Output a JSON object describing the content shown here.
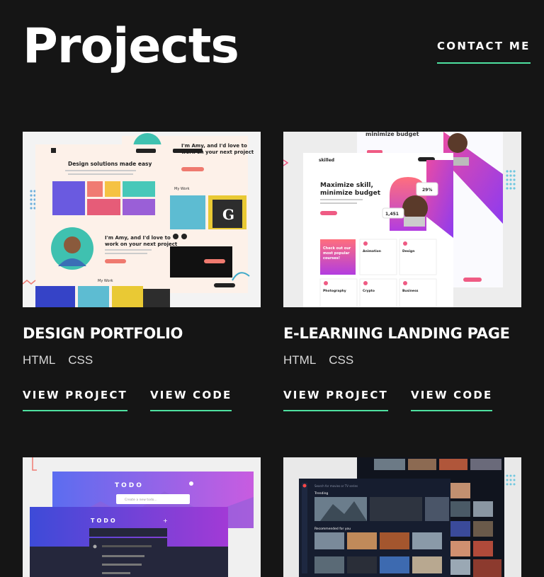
{
  "header": {
    "title": "Projects",
    "contact_label": "CONTACT ME"
  },
  "accent": "#4ee1a0",
  "projects": [
    {
      "title": "DESIGN PORTFOLIO",
      "tags": [
        "HTML",
        "CSS"
      ],
      "view_project": "VIEW PROJECT",
      "view_code": "VIEW CODE",
      "thumb_text": {
        "heading": "Design solutions made easy",
        "intro": "I'm Amy, and I'd love to work on your next project",
        "intro2": "I'm Amy, and I'd love to work on your next project",
        "section": "My Work",
        "section2": "My Work"
      }
    },
    {
      "title": "E-LEARNING LANDING PAGE",
      "tags": [
        "HTML",
        "CSS"
      ],
      "view_project": "VIEW PROJECT",
      "view_code": "VIEW CODE",
      "thumb_text": {
        "brand": "skilled",
        "heading": "Maximize skill, minimize budget",
        "top": "minimize budget",
        "stat1": "29%",
        "stat2": "1,451",
        "cta": "Check out our most popular courses!",
        "c1": "Animation",
        "c2": "Design",
        "c3": "Photography",
        "c4": "Crypto",
        "c5": "Business"
      }
    },
    {
      "title": "",
      "tags": [],
      "thumb_text": {
        "logo": "TODO",
        "logo2": "TODO",
        "placeholder": "Create a new todo..."
      }
    },
    {
      "title": "",
      "tags": [],
      "thumb_text": {
        "section1": "Trending",
        "section2": "Recommended for you",
        "search": "Search for movies or TV series"
      }
    }
  ]
}
